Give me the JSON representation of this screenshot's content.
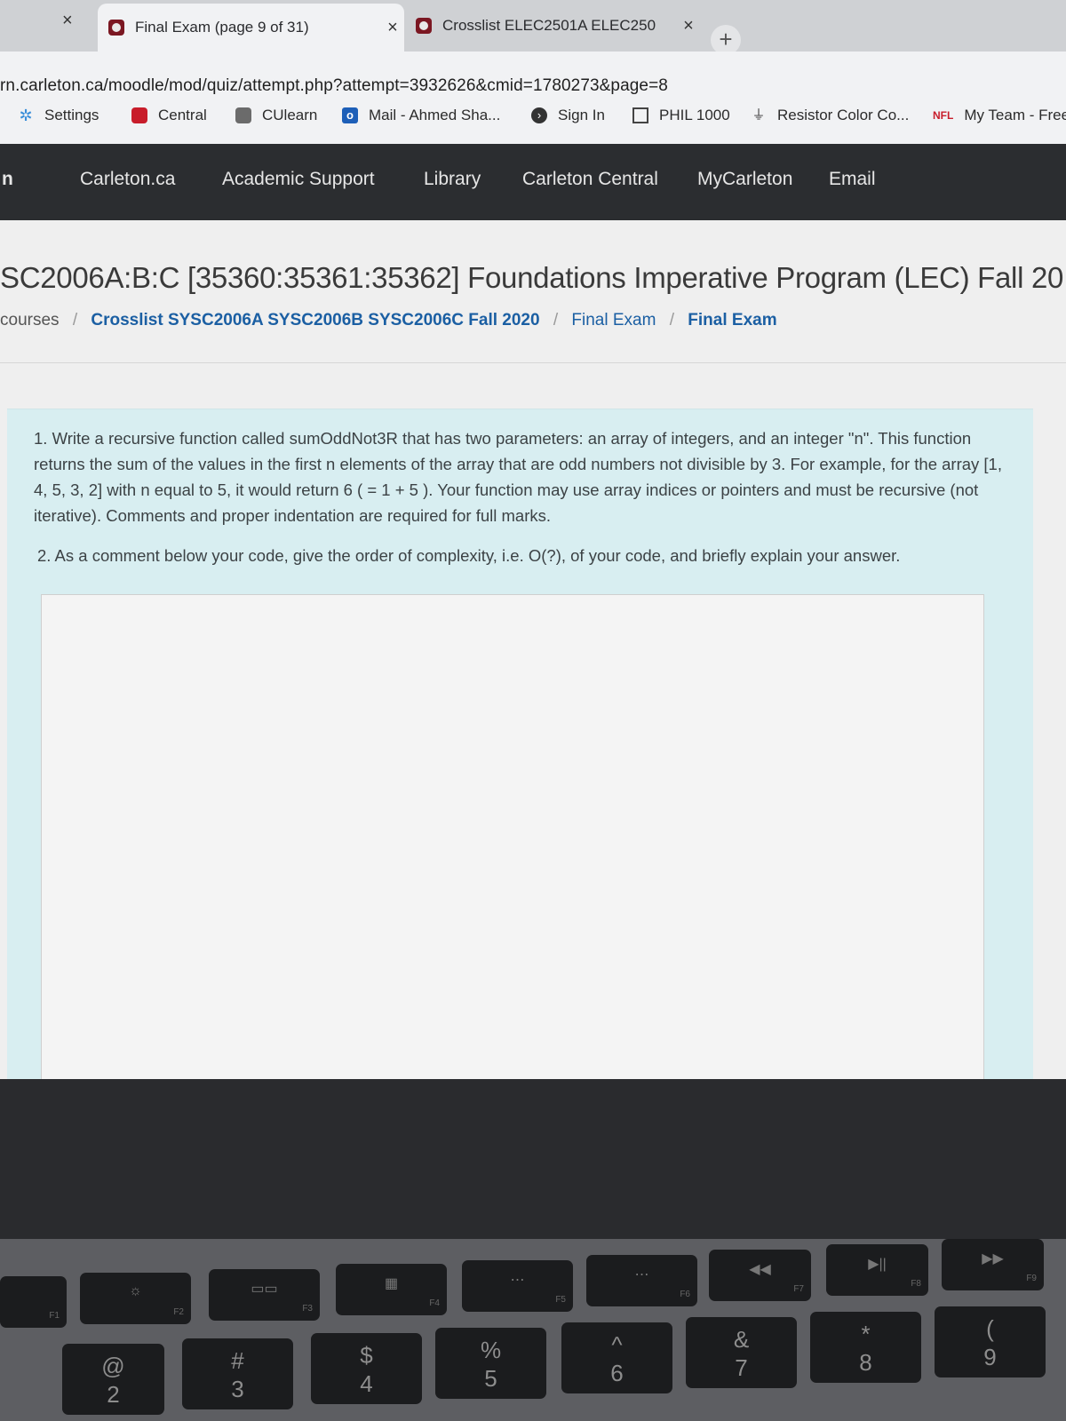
{
  "browser": {
    "tabs": [
      {
        "title": "Final Exam (page 9 of 31)",
        "close": "×",
        "active": true
      },
      {
        "title": "Crosslist ELEC2501A ELEC250",
        "close": "×",
        "active": false
      }
    ],
    "stray_close": "×",
    "new_tab": "+",
    "url": "rn.carleton.ca/moodle/mod/quiz/attempt.php?attempt=3932626&cmid=1780273&page=8",
    "bookmarks": [
      {
        "label": "Settings",
        "icon": "gear-icon"
      },
      {
        "label": "Central",
        "icon": "carleton-shield-icon"
      },
      {
        "label": "CUlearn",
        "icon": "carleton-shield-icon"
      },
      {
        "label": "Mail - Ahmed Sha...",
        "icon": "outlook-icon"
      },
      {
        "label": "Sign In",
        "icon": "signin-icon"
      },
      {
        "label": "PHIL 1000",
        "icon": "calculator-icon"
      },
      {
        "label": "Resistor Color Co...",
        "icon": "resistor-icon"
      },
      {
        "label": "My Team - Free",
        "icon": "nfl-icon",
        "icon_text": "NFL"
      }
    ]
  },
  "site_nav": {
    "brand_fragment": "n",
    "items": [
      "Carleton.ca",
      "Academic Support",
      "Library",
      "Carleton Central",
      "MyCarleton",
      "Email"
    ]
  },
  "page": {
    "course_title": "SC2006A:B:C [35360:35361:35362] Foundations Imperative Program (LEC) Fall 20",
    "breadcrumb": [
      "courses",
      "Crosslist SYSC2006A SYSC2006B SYSC2006C Fall 2020",
      "Final Exam",
      "Final Exam"
    ],
    "breadcrumb_sep": "/",
    "question": {
      "part1": "1. Write a recursive function called sumOddNot3R that has two parameters: an array of integers, and an integer \"n\". This function returns the sum of the values in the first n elements of the array that are odd numbers not divisible by 3. For example, for the array [1, 4, 5, 3, 2] with n equal to 5, it would return 6 ( = 1 + 5 ). Your function may use array indices or pointers and must be recursive (not iterative). Comments and proper indentation are required for full marks.",
      "part2": "2. As a comment below your code, give the order of complexity, i.e. O(?), of your code, and briefly explain your answer."
    },
    "answer_value": ""
  },
  "keyboard": {
    "function_keys": [
      {
        "label": "F1",
        "icon": ""
      },
      {
        "label": "F2",
        "icon": "☼"
      },
      {
        "label": "F3",
        "icon": "▭▭"
      },
      {
        "label": "F4",
        "icon": "▦"
      },
      {
        "label": "F5",
        "icon": "⋯"
      },
      {
        "label": "F6",
        "icon": "⋯"
      },
      {
        "label": "F7",
        "icon": "◀◀"
      },
      {
        "label": "F8",
        "icon": "▶||"
      },
      {
        "label": "F9",
        "icon": "▶▶"
      }
    ],
    "number_keys": [
      {
        "top": "@",
        "bottom": "2"
      },
      {
        "top": "#",
        "bottom": "3"
      },
      {
        "top": "$",
        "bottom": "4"
      },
      {
        "top": "%",
        "bottom": "5"
      },
      {
        "top": "^",
        "bottom": "6"
      },
      {
        "top": "&",
        "bottom": "7"
      },
      {
        "top": "*",
        "bottom": "8"
      },
      {
        "top": "(",
        "bottom": "9"
      }
    ]
  }
}
